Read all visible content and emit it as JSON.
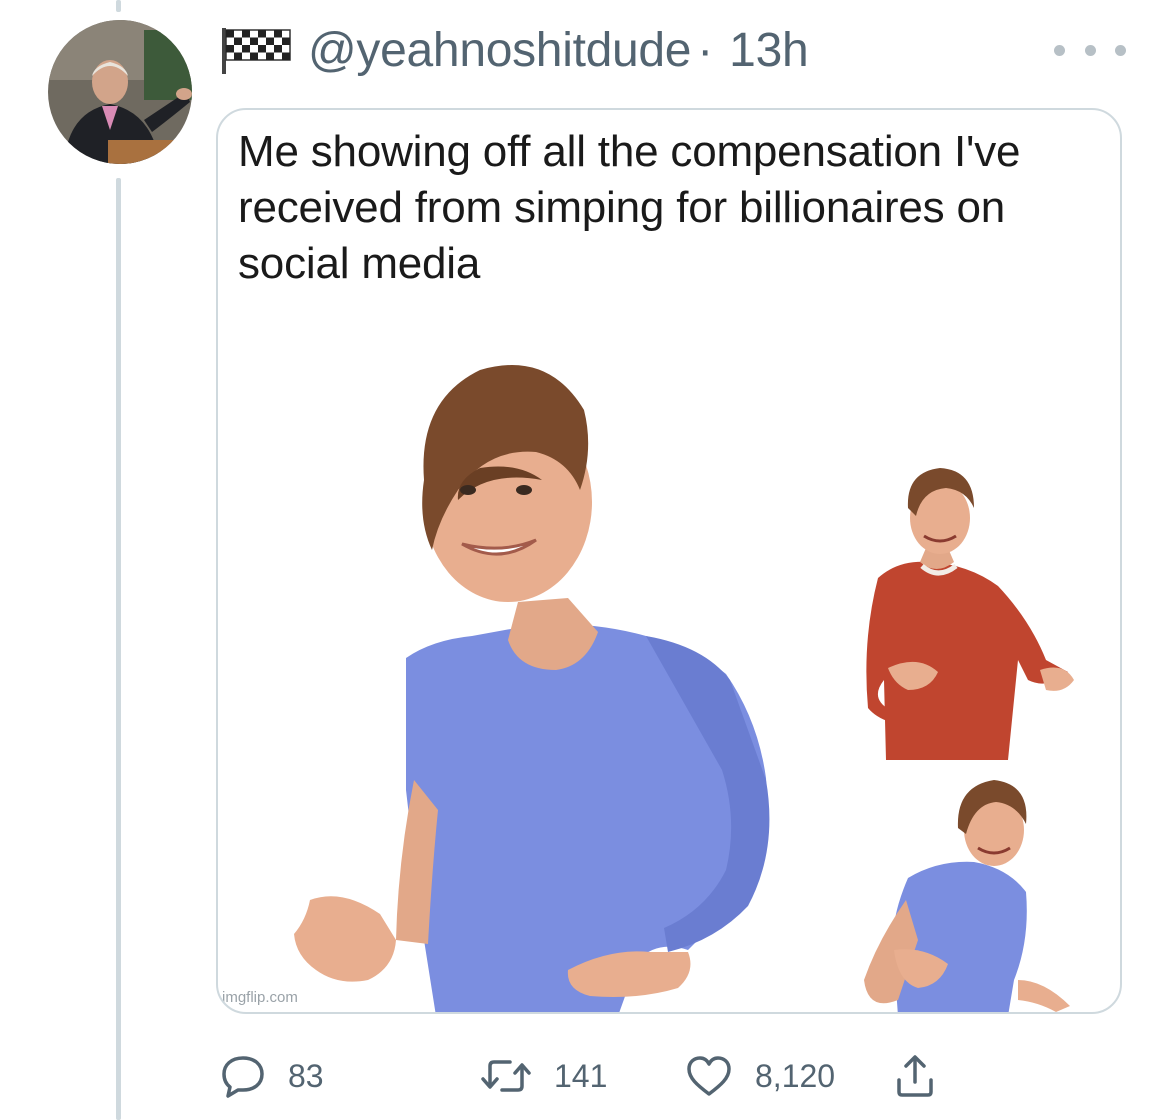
{
  "tweet": {
    "handle": "@yeahnoshitdude",
    "separator": "·",
    "time": "13h",
    "more_icon": "more-horizontal-icon",
    "flag_icon": "checkered-flag-icon"
  },
  "media": {
    "caption": "Me showing off all the compensation I've received from simping for billionaires on social media",
    "watermark": "imgflip.com"
  },
  "actions": {
    "reply_count": "83",
    "retweet_count": "141",
    "like_count": "8,120",
    "icons": [
      "reply-icon",
      "retweet-icon",
      "like-icon",
      "share-icon"
    ]
  },
  "colors": {
    "secondary_text": "#536471",
    "border": "#cfd9de",
    "shirt_blue": "#7b8ee0",
    "sweater_red": "#c0452f"
  }
}
